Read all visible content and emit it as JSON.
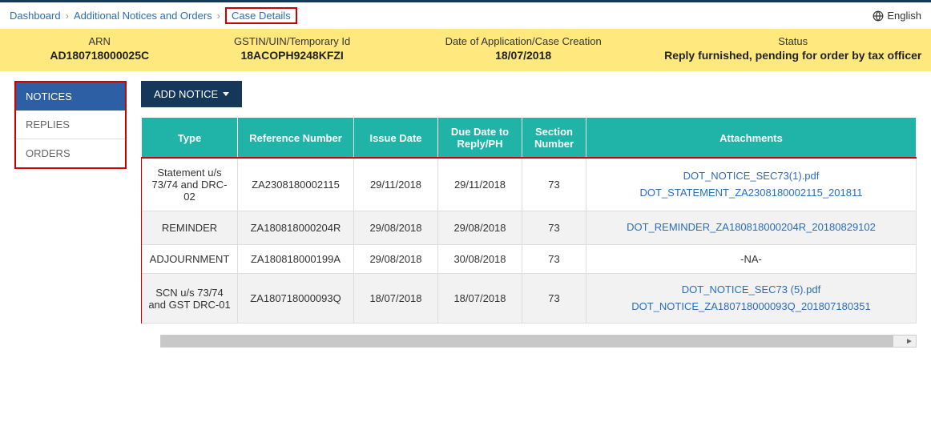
{
  "breadcrumb": {
    "items": [
      "Dashboard",
      "Additional Notices and Orders",
      "Case Details"
    ],
    "sep": "›"
  },
  "language": "English",
  "summary": {
    "arn_label": "ARN",
    "arn_value": "AD180718000025C",
    "gstin_label": "GSTIN/UIN/Temporary Id",
    "gstin_value": "18ACOPH9248KFZI",
    "date_label": "Date of Application/Case Creation",
    "date_value": "18/07/2018",
    "status_label": "Status",
    "status_value": "Reply furnished, pending for order by tax officer"
  },
  "sidebar": {
    "items": [
      {
        "label": "NOTICES",
        "active": true
      },
      {
        "label": "REPLIES",
        "active": false
      },
      {
        "label": "ORDERS",
        "active": false
      }
    ]
  },
  "buttons": {
    "add_notice": "ADD NOTICE"
  },
  "table": {
    "headers": {
      "type": "Type",
      "ref": "Reference Number",
      "issue": "Issue Date",
      "due": "Due Date to Reply/PH",
      "section": "Section Number",
      "attachments": "Attachments"
    },
    "rows": [
      {
        "type": "Statement u/s 73/74 and DRC-02",
        "ref": "ZA2308180002115",
        "issue": "29/11/2018",
        "due": "29/11/2018",
        "section": "73",
        "attachments": [
          "DOT_NOTICE_SEC73(1).pdf",
          "DOT_STATEMENT_ZA2308180002115_201811"
        ]
      },
      {
        "type": "REMINDER",
        "ref": "ZA180818000204R",
        "issue": "29/08/2018",
        "due": "29/08/2018",
        "section": "73",
        "attachments": [
          "DOT_REMINDER_ZA180818000204R_20180829102"
        ]
      },
      {
        "type": "ADJOURNMENT",
        "ref": "ZA180818000199A",
        "issue": "29/08/2018",
        "due": "30/08/2018",
        "section": "73",
        "attachments": [],
        "na": "-NA-"
      },
      {
        "type": "SCN u/s 73/74 and GST DRC-01",
        "ref": "ZA180718000093Q",
        "issue": "18/07/2018",
        "due": "18/07/2018",
        "section": "73",
        "attachments": [
          "DOT_NOTICE_SEC73 (5).pdf",
          "DOT_NOTICE_ZA180718000093Q_201807180351"
        ]
      }
    ]
  }
}
